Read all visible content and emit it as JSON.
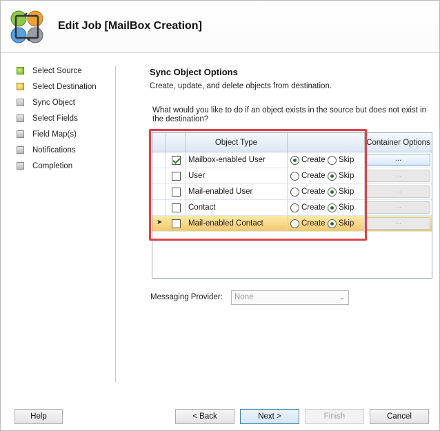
{
  "window": {
    "title": "Edit Job [MailBox Creation]"
  },
  "sidebar": {
    "steps": [
      {
        "label": "Select Source",
        "state": "done"
      },
      {
        "label": "Select Destination",
        "state": "current"
      },
      {
        "label": "Sync Object",
        "state": "pending"
      },
      {
        "label": "Select Fields",
        "state": "pending"
      },
      {
        "label": "Field Map(s)",
        "state": "pending"
      },
      {
        "label": "Notifications",
        "state": "pending"
      },
      {
        "label": "Completion",
        "state": "pending"
      }
    ]
  },
  "main": {
    "title": "Sync Object Options",
    "subtitle": "Create, update, and delete objects from destination.",
    "question": "What would you like to do if an object exists in the source but does not exist in the destination?",
    "grid": {
      "columns": {
        "object_type": "Object Type",
        "options": "",
        "container_options": "Container Options"
      },
      "create_label": "Create",
      "skip_label": "Skip",
      "container_btn_label": "...",
      "rows": [
        {
          "checked": true,
          "type": "Mailbox-enabled User",
          "action": "Create",
          "selected": false
        },
        {
          "checked": false,
          "type": "User",
          "action": "Skip",
          "selected": false
        },
        {
          "checked": false,
          "type": "Mail-enabled User",
          "action": "Skip",
          "selected": false
        },
        {
          "checked": false,
          "type": "Contact",
          "action": "Skip",
          "selected": false
        },
        {
          "checked": false,
          "type": "Mail-enabled Contact",
          "action": "Skip",
          "selected": true
        }
      ]
    },
    "messaging_provider": {
      "label": "Messaging Provider:",
      "value": "None"
    }
  },
  "footer": {
    "help": "Help",
    "back": "< Back",
    "next": "Next >",
    "finish": "Finish",
    "cancel": "Cancel"
  },
  "colors": {
    "accent_highlight": "#e0404a",
    "row_selected": "#f5c66b",
    "step_done": "#6fb22c",
    "step_current": "#d8b32a"
  }
}
